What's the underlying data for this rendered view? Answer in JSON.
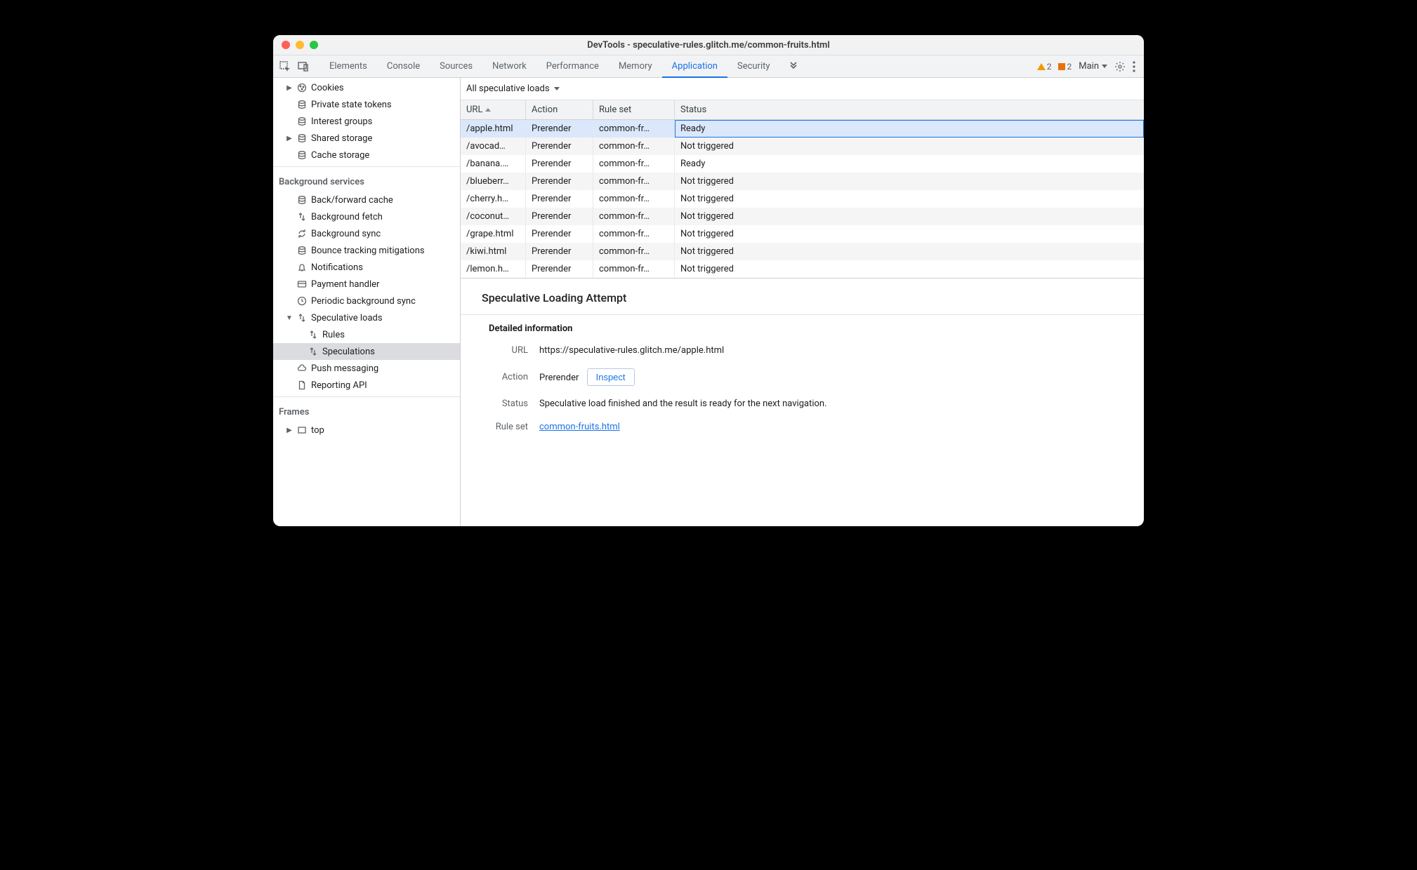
{
  "window": {
    "title": "DevTools - speculative-rules.glitch.me/common-fruits.html"
  },
  "tabs": {
    "items": [
      "Elements",
      "Console",
      "Sources",
      "Network",
      "Performance",
      "Memory",
      "Application",
      "Security"
    ],
    "active_index": 6,
    "warnings": "2",
    "issues": "2",
    "main_label": "Main"
  },
  "sidebar": {
    "storage": [
      {
        "label": "Cookies",
        "icon": "cookie",
        "has_children": true,
        "indent": 1
      },
      {
        "label": "Private state tokens",
        "icon": "db",
        "indent": 1
      },
      {
        "label": "Interest groups",
        "icon": "db",
        "indent": 1
      },
      {
        "label": "Shared storage",
        "icon": "db",
        "has_children": true,
        "indent": 1
      },
      {
        "label": "Cache storage",
        "icon": "db",
        "indent": 1
      }
    ],
    "bg_head": "Background services",
    "bg": [
      {
        "label": "Back/forward cache",
        "icon": "db",
        "indent": 1
      },
      {
        "label": "Background fetch",
        "icon": "arrows",
        "indent": 1
      },
      {
        "label": "Background sync",
        "icon": "sync",
        "indent": 1
      },
      {
        "label": "Bounce tracking mitigations",
        "icon": "db",
        "indent": 1
      },
      {
        "label": "Notifications",
        "icon": "bell",
        "indent": 1
      },
      {
        "label": "Payment handler",
        "icon": "card",
        "indent": 1
      },
      {
        "label": "Periodic background sync",
        "icon": "clock",
        "indent": 1
      },
      {
        "label": "Speculative loads",
        "icon": "arrows",
        "has_children": true,
        "expanded": true,
        "indent": 1
      },
      {
        "label": "Rules",
        "icon": "arrows",
        "indent": 2,
        "parent": "spec"
      },
      {
        "label": "Speculations",
        "icon": "arrows",
        "indent": 2,
        "parent": "spec",
        "selected": true
      },
      {
        "label": "Push messaging",
        "icon": "cloud",
        "indent": 1
      },
      {
        "label": "Reporting API",
        "icon": "page",
        "indent": 1
      }
    ],
    "frames_head": "Frames",
    "frames": [
      {
        "label": "top",
        "icon": "frame",
        "has_children": true,
        "indent": 1
      }
    ]
  },
  "content": {
    "dropdown_label": "All speculative loads",
    "columns": [
      "URL",
      "Action",
      "Rule set",
      "Status"
    ],
    "rows": [
      {
        "url": "/apple.html",
        "action": "Prerender",
        "rule": "common-fr…",
        "status": "Ready",
        "selected": true
      },
      {
        "url": "/avocad…",
        "action": "Prerender",
        "rule": "common-fr…",
        "status": "Not triggered"
      },
      {
        "url": "/banana.…",
        "action": "Prerender",
        "rule": "common-fr…",
        "status": "Ready"
      },
      {
        "url": "/blueberr…",
        "action": "Prerender",
        "rule": "common-fr…",
        "status": "Not triggered"
      },
      {
        "url": "/cherry.h…",
        "action": "Prerender",
        "rule": "common-fr…",
        "status": "Not triggered"
      },
      {
        "url": "/coconut…",
        "action": "Prerender",
        "rule": "common-fr…",
        "status": "Not triggered"
      },
      {
        "url": "/grape.html",
        "action": "Prerender",
        "rule": "common-fr…",
        "status": "Not triggered"
      },
      {
        "url": "/kiwi.html",
        "action": "Prerender",
        "rule": "common-fr…",
        "status": "Not triggered"
      },
      {
        "url": "/lemon.h…",
        "action": "Prerender",
        "rule": "common-fr…",
        "status": "Not triggered"
      }
    ],
    "details": {
      "heading": "Speculative Loading Attempt",
      "subheading": "Detailed information",
      "url_label": "URL",
      "url_value": "https://speculative-rules.glitch.me/apple.html",
      "action_label": "Action",
      "action_value": "Prerender",
      "inspect_label": "Inspect",
      "status_label": "Status",
      "status_value": "Speculative load finished and the result is ready for the next navigation.",
      "ruleset_label": "Rule set",
      "ruleset_value": "common-fruits.html"
    }
  }
}
